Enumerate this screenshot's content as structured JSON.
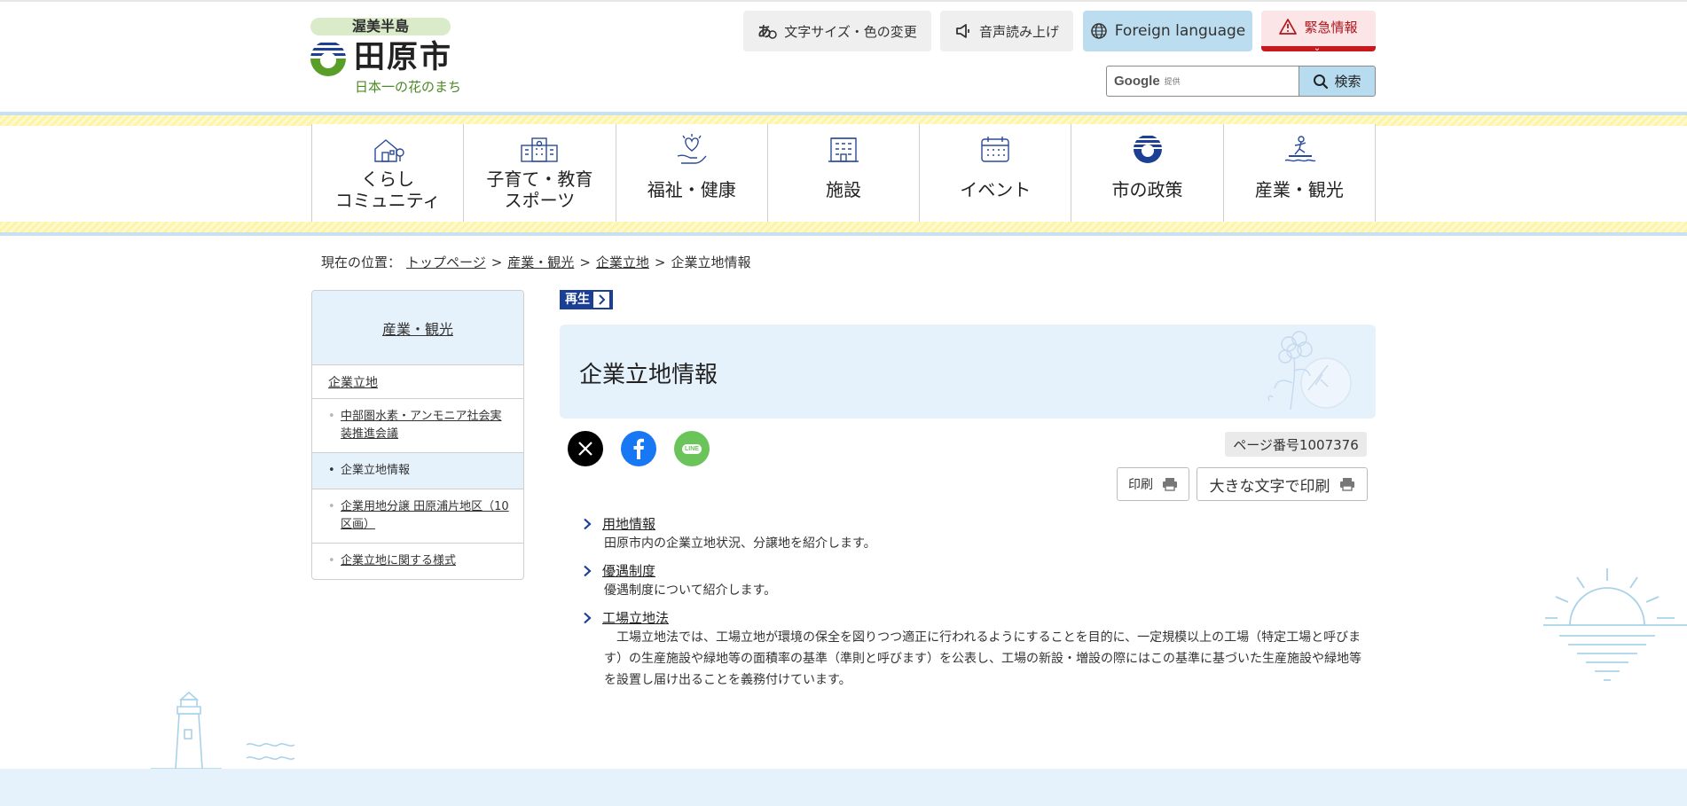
{
  "header": {
    "logo": {
      "peninsula": "渥美半島",
      "city": "田原市",
      "tagline": "日本一の花のまち"
    },
    "buttons": {
      "text_size": "文字サイズ・色の変更",
      "voice": "音声読み上げ",
      "foreign": "Foreign language",
      "emergency": "緊急情報"
    },
    "search": {
      "google": "Google",
      "provided": "提供",
      "button": "検索"
    }
  },
  "nav": [
    {
      "label": "くらし\nコミュニティ",
      "icon": "house-icon"
    },
    {
      "label": "子育て・教育\nスポーツ",
      "icon": "school-icon"
    },
    {
      "label": "福祉・健康",
      "icon": "heart-hand-icon"
    },
    {
      "label": "施設",
      "icon": "building-icon"
    },
    {
      "label": "イベント",
      "icon": "calendar-icon"
    },
    {
      "label": "市の政策",
      "icon": "city-emblem-icon"
    },
    {
      "label": "産業・観光",
      "icon": "surfer-icon"
    }
  ],
  "breadcrumb": {
    "prefix": "現在の位置：",
    "items": [
      "トップページ",
      "産業・観光",
      "企業立地"
    ],
    "sep": ">",
    "current": "企業立地情報"
  },
  "sidebar": {
    "heading": "産業・観光",
    "section": "企業立地",
    "items": [
      {
        "label": "中部圏水素・アンモニア社会実装推進会議",
        "current": false
      },
      {
        "label": "企業立地情報",
        "current": true
      },
      {
        "label": "企業用地分譲 田原浦片地区（10区画）",
        "current": false
      },
      {
        "label": "企業立地に関する様式",
        "current": false
      }
    ]
  },
  "main": {
    "play_label": "再生",
    "title": "企業立地情報",
    "page_number": "ページ番号1007376",
    "print": "印刷",
    "print_large": "大きな文字で印刷",
    "links": [
      {
        "title": "用地情報",
        "desc": "田原市内の企業立地状況、分譲地を紹介します。"
      },
      {
        "title": "優遇制度",
        "desc": "優遇制度について紹介します。"
      },
      {
        "title": "工場立地法",
        "desc": "　工場立地法では、工場立地が環境の保全を図りつつ適正に行われるようにすることを目的に、一定規模以上の工場（特定工場と呼びます）の生産施設や緑地等の面積率の基準（準則と呼びます）を公表し、工場の新設・増設の際にはこの基準に基づいた生産施設や緑地等を設置し届け出ることを義務付けています。"
      }
    ]
  },
  "colors": {
    "nav_stripe": "#fff4a3",
    "light_blue": "#e6f2fb",
    "foreign_button": "#bcdcef",
    "emergency_red": "#c8191f",
    "play_blue": "#1c3f96"
  }
}
